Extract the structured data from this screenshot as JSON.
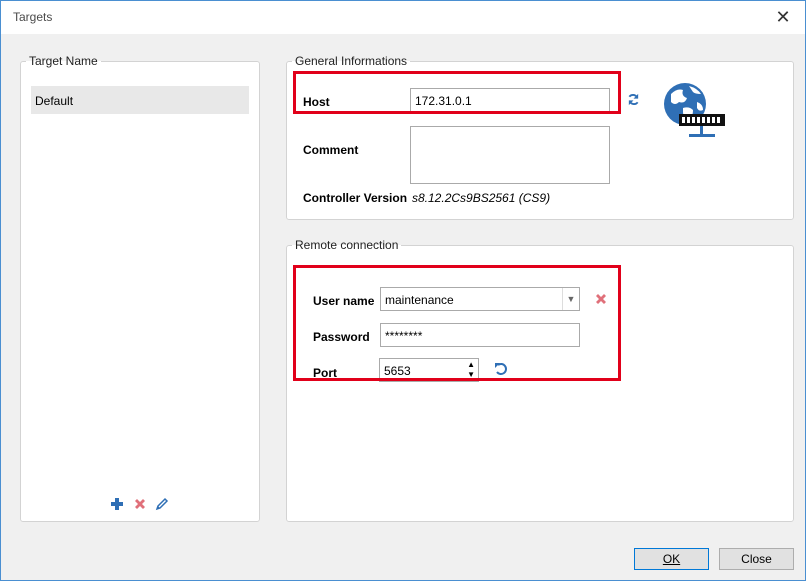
{
  "window": {
    "title": "Targets",
    "close_label": "✕"
  },
  "targets": {
    "legend": "Target Name",
    "items": [
      {
        "label": "Default"
      }
    ]
  },
  "general": {
    "legend": "General Informations",
    "host_label": "Host",
    "host_value": "172.31.0.1",
    "comment_label": "Comment",
    "comment_value": "",
    "controller_label": "Controller Version",
    "controller_value": "s8.12.2Cs9BS2561 (CS9)"
  },
  "remote": {
    "legend": "Remote connection",
    "username_label": "User name",
    "username_value": "maintenance",
    "password_label": "Password",
    "password_value": "********",
    "port_label": "Port",
    "port_value": "5653"
  },
  "buttons": {
    "ok": "OK",
    "close": "Close"
  },
  "colors": {
    "highlight": "#e1001a",
    "icon_blue": "#2f6fb5",
    "delete_red": "#e0707a"
  }
}
